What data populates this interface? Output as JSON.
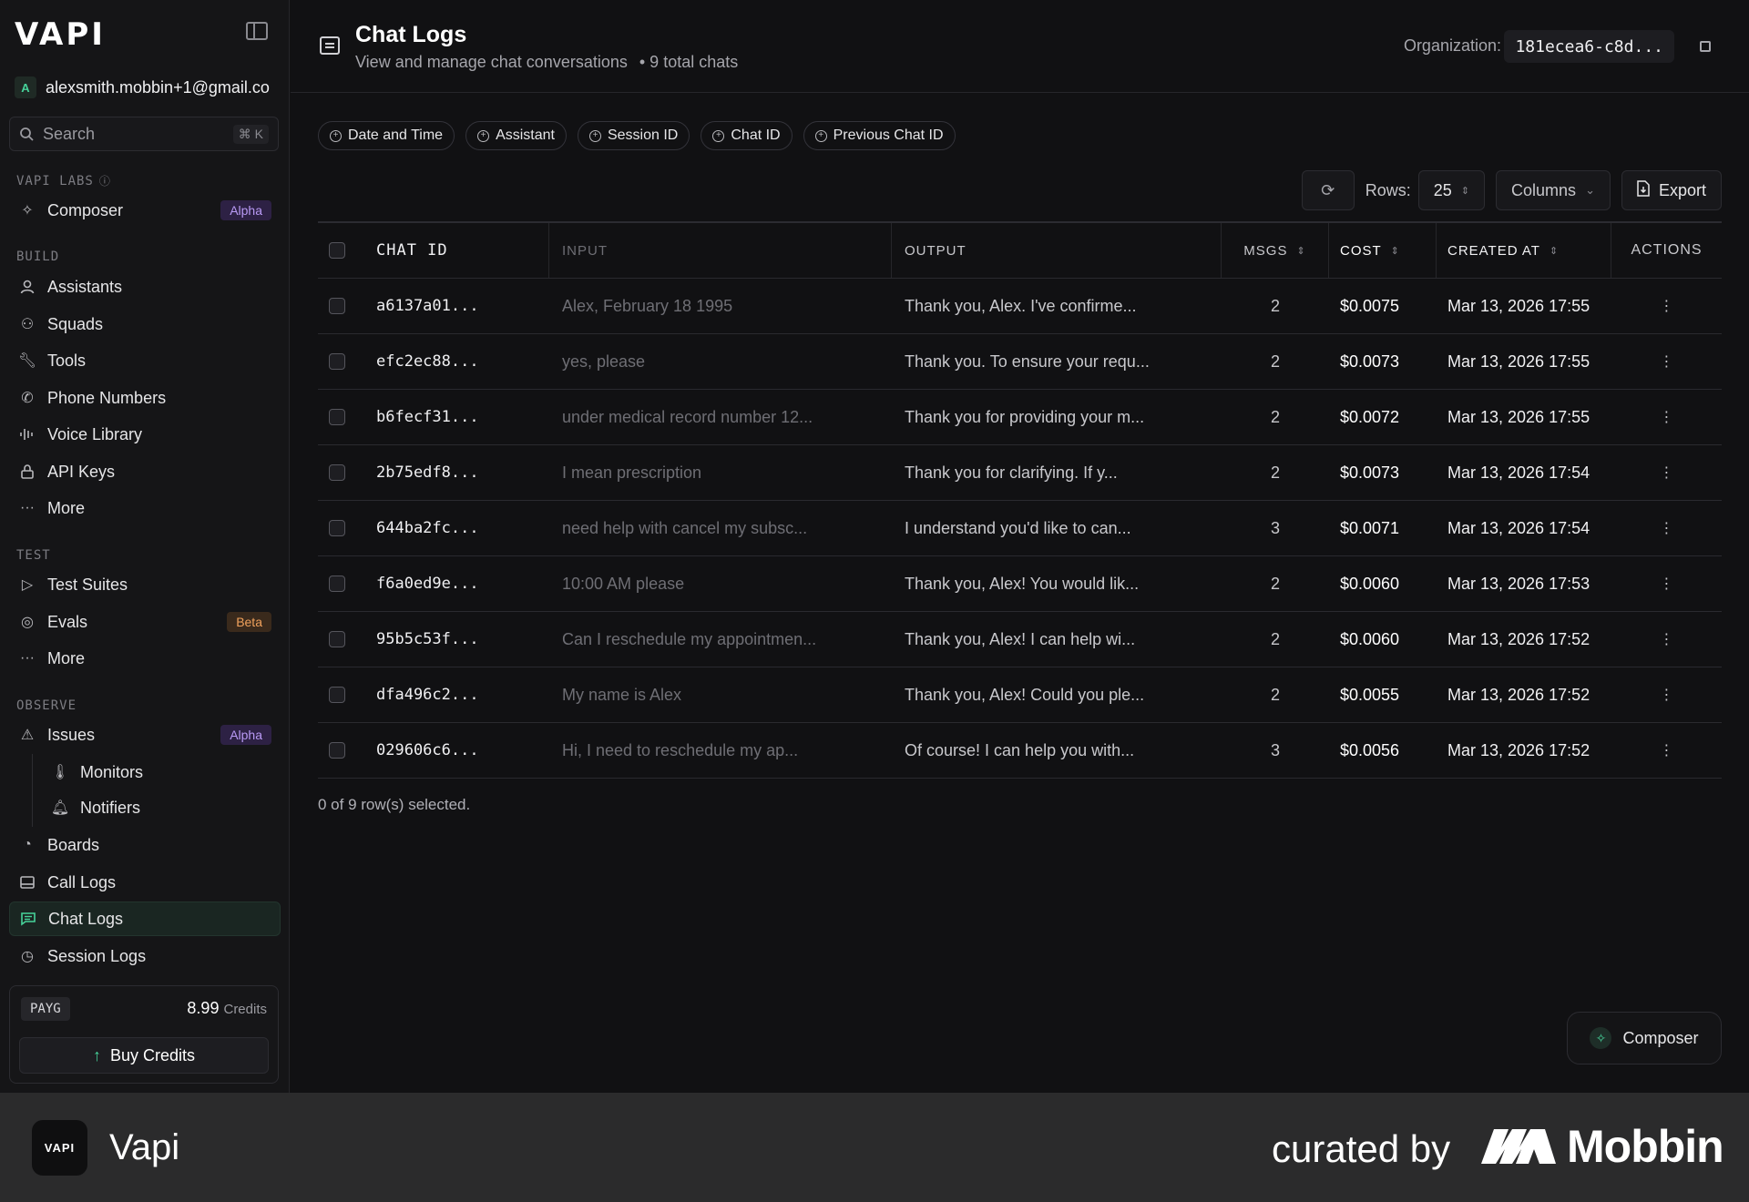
{
  "brand": {
    "logo": "VAPI"
  },
  "account": {
    "initial": "A",
    "email": "alexsmith.mobbin+1@gmail.co"
  },
  "search": {
    "placeholder": "Search",
    "shortcut": "⌘ K"
  },
  "sections": {
    "labs": "VAPI LABS",
    "build": "BUILD",
    "test": "TEST",
    "observe": "OBSERVE"
  },
  "nav": {
    "composer": {
      "label": "Composer",
      "badge": "Alpha"
    },
    "assistants": "Assistants",
    "squads": "Squads",
    "tools": "Tools",
    "phone_numbers": "Phone Numbers",
    "voice_library": "Voice Library",
    "api_keys": "API Keys",
    "more_build": "More",
    "test_suites": "Test Suites",
    "evals": {
      "label": "Evals",
      "badge": "Beta"
    },
    "more_test": "More",
    "issues": {
      "label": "Issues",
      "badge": "Alpha"
    },
    "monitors": "Monitors",
    "notifiers": "Notifiers",
    "boards": "Boards",
    "call_logs": "Call Logs",
    "chat_logs": "Chat Logs",
    "session_logs": "Session Logs"
  },
  "credits": {
    "plan": "PAYG",
    "amount": "8.99",
    "unit": "Credits",
    "buy_label": "Buy Credits"
  },
  "header": {
    "title": "Chat Logs",
    "subtitle": "View and manage chat conversations",
    "total": "• 9 total chats",
    "org_label": "Organization:",
    "org_value": "181ecea6-c8d..."
  },
  "filters": [
    "Date and Time",
    "Assistant",
    "Session ID",
    "Chat ID",
    "Previous Chat ID"
  ],
  "toolbar": {
    "rows_label": "Rows:",
    "rows_value": "25",
    "columns_label": "Columns",
    "export_label": "Export"
  },
  "table": {
    "headers": {
      "chat_id": "CHAT ID",
      "input": "INPUT",
      "output": "OUTPUT",
      "msgs": "MSGS",
      "cost": "COST",
      "created_at": "CREATED AT",
      "actions": "ACTIONS"
    },
    "rows": [
      {
        "id": "a6137a01...",
        "input": "Alex, February 18 1995",
        "output": "Thank you, Alex. I've confirme...",
        "msgs": "2",
        "cost": "$0.0075",
        "created": "Mar 13, 2026 17:55"
      },
      {
        "id": "efc2ec88...",
        "input": "yes, please",
        "output": "Thank you. To ensure your requ...",
        "msgs": "2",
        "cost": "$0.0073",
        "created": "Mar 13, 2026 17:55"
      },
      {
        "id": "b6fecf31...",
        "input": "under medical record number 12...",
        "output": "Thank you for providing your m...",
        "msgs": "2",
        "cost": "$0.0072",
        "created": "Mar 13, 2026 17:55"
      },
      {
        "id": "2b75edf8...",
        "input": "I mean prescription",
        "output": "Thank you for clarifying. If y...",
        "msgs": "2",
        "cost": "$0.0073",
        "created": "Mar 13, 2026 17:54"
      },
      {
        "id": "644ba2fc...",
        "input": "need help with cancel my subsc...",
        "output": "I understand you'd like to can...",
        "msgs": "3",
        "cost": "$0.0071",
        "created": "Mar 13, 2026 17:54"
      },
      {
        "id": "f6a0ed9e...",
        "input": "10:00 AM please",
        "output": "Thank you, Alex! You would lik...",
        "msgs": "2",
        "cost": "$0.0060",
        "created": "Mar 13, 2026 17:53"
      },
      {
        "id": "95b5c53f...",
        "input": "Can I reschedule my appointmen...",
        "output": "Thank you, Alex! I can help wi...",
        "msgs": "2",
        "cost": "$0.0060",
        "created": "Mar 13, 2026 17:52"
      },
      {
        "id": "dfa496c2...",
        "input": "My name is Alex",
        "output": "Thank you, Alex! Could you ple...",
        "msgs": "2",
        "cost": "$0.0055",
        "created": "Mar 13, 2026 17:52"
      },
      {
        "id": "029606c6...",
        "input": "Hi, I need to reschedule my ap...",
        "output": "Of course! I can help you with...",
        "msgs": "3",
        "cost": "$0.0056",
        "created": "Mar 13, 2026 17:52"
      }
    ],
    "selection": "0 of 9 row(s) selected."
  },
  "fab": {
    "label": "Composer"
  },
  "footer": {
    "app_icon_text": "VAPI",
    "app_name": "Vapi",
    "curated": "curated by",
    "mobbin": "Mobbin"
  },
  "colors": {
    "accent": "#46d39a",
    "alpha_badge": "#b99af5",
    "beta_badge": "#f0a15c",
    "background": "#111113"
  }
}
